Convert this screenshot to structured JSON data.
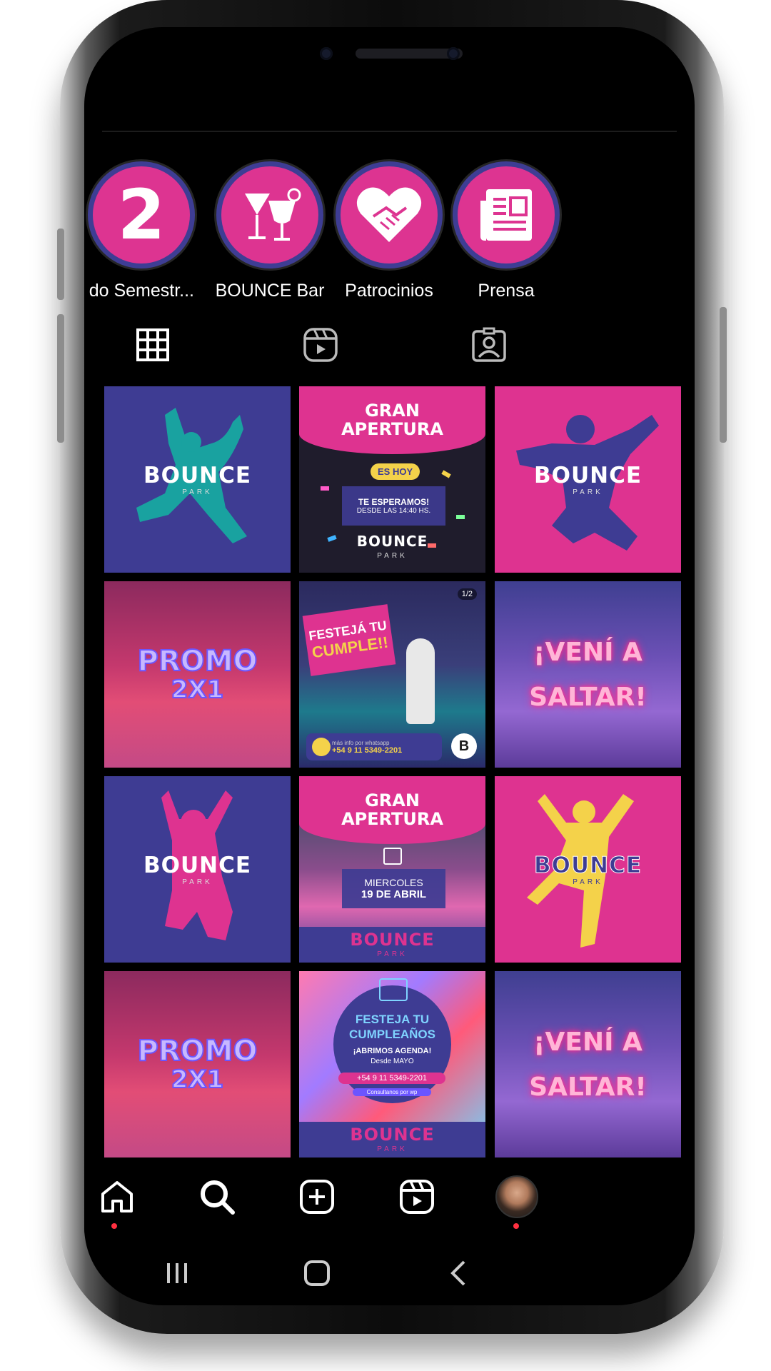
{
  "highlights": [
    {
      "label": "do Semestr...",
      "icon": "number-2-icon"
    },
    {
      "label": "BOUNCE Bar",
      "icon": "cocktail-glasses-icon"
    },
    {
      "label": "Patrocinios",
      "icon": "handshake-heart-icon"
    },
    {
      "label": "Prensa",
      "icon": "newspaper-icon"
    }
  ],
  "tabs": [
    {
      "name": "posts-grid",
      "icon": "grid-icon",
      "active": true
    },
    {
      "name": "reels",
      "icon": "reels-icon",
      "active": false
    },
    {
      "name": "tagged",
      "icon": "tagged-person-icon",
      "active": false
    }
  ],
  "posts": {
    "logo_text": "BOUNCE",
    "logo_sub": "PARK",
    "gran_apertura_1": {
      "title_line1": "GRAN",
      "title_line2": "APERTURA",
      "badge": "ES HOY",
      "line1": "TE ESPERAMOS!",
      "line2": "DESDE LAS 14:40 HS."
    },
    "promo": {
      "line1": "PROMO",
      "line2": "2X1"
    },
    "festeja": {
      "line1": "FESTEJÁ TU",
      "line2": "CUMPLE!!",
      "counter": "1/2",
      "info": "más info por whatsapp",
      "phone": "+54 9 11 5349-2201"
    },
    "veni": {
      "line1": "¡VENÍ A",
      "line2": "SALTAR!"
    },
    "gran_apertura_2": {
      "title_line1": "GRAN",
      "title_line2": "APERTURA",
      "day": "MIERCOLES",
      "date": "19 DE ABRIL"
    },
    "cumple": {
      "line1": "FESTEJA TU",
      "line2": "CUMPLEAÑOS",
      "line3": "¡ABRIMOS AGENDA!",
      "line4": "Desde MAYO",
      "phone": "+54 9 11 5349-2201",
      "note": "Consultanos por wp"
    }
  },
  "bottom_nav": [
    "home-icon",
    "search-icon",
    "create-post-icon",
    "reels-icon",
    "profile-avatar"
  ],
  "colors": {
    "brand_blue": "#3e3c93",
    "brand_pink": "#de3390",
    "accent_yellow": "#f4d24a",
    "accent_teal": "#19a2a0",
    "notification": "#ff3040"
  }
}
